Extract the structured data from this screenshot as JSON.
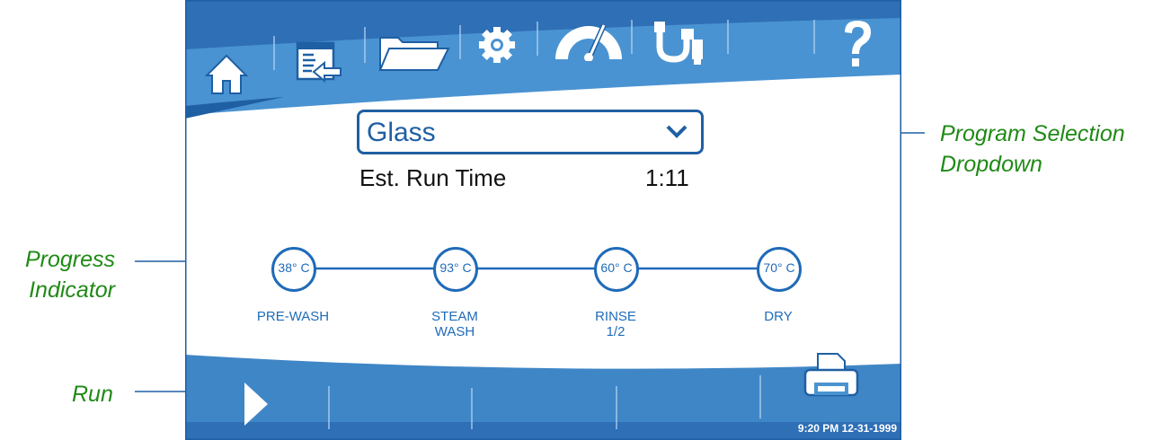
{
  "annotations": {
    "program_selection_line1": "Program Selection",
    "program_selection_line2": "Dropdown",
    "progress_line1": "Progress",
    "progress_line2": "Indicator",
    "run": "Run"
  },
  "program": {
    "selected": "Glass",
    "runtime_label": "Est. Run Time",
    "runtime_value": "1:11"
  },
  "stages": [
    {
      "temp": "38° C",
      "label_line1": "PRE-WASH",
      "label_line2": ""
    },
    {
      "temp": "93° C",
      "label_line1": "STEAM",
      "label_line2": "WASH"
    },
    {
      "temp": "60° C",
      "label_line1": "RINSE",
      "label_line2": "1/2"
    },
    {
      "temp": "70° C",
      "label_line1": "DRY",
      "label_line2": ""
    }
  ],
  "status": {
    "timestamp": "9:20 PM 12-31-1999"
  },
  "colors": {
    "blue_dark": "#1f5fa3",
    "blue_mid": "#3f86c6",
    "blue_light": "#5a9fd7",
    "accent_green": "#1f8a16"
  },
  "icons": [
    "home-icon",
    "import-icon",
    "folder-icon",
    "settings-icon",
    "gauge-icon",
    "usb-icon",
    "help-icon",
    "run-icon",
    "printer-icon"
  ]
}
